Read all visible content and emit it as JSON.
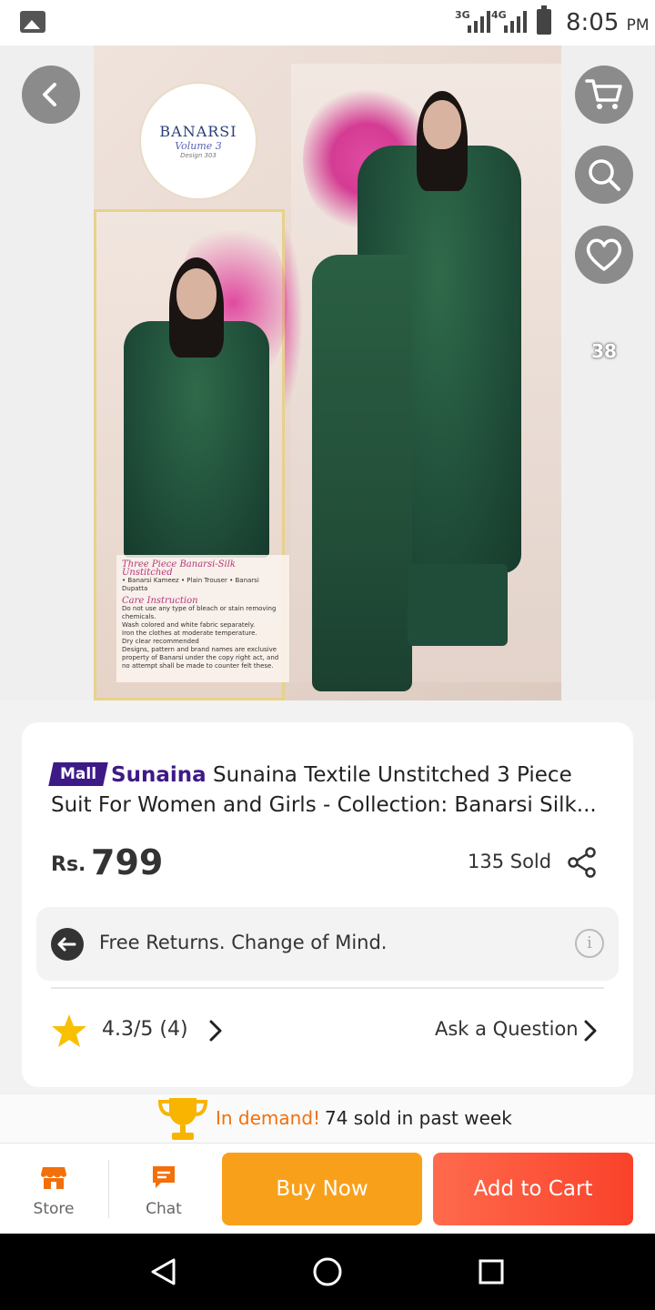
{
  "status_bar": {
    "network_1": "3G",
    "network_2": "4G",
    "time": "8:05",
    "ampm": "PM"
  },
  "gallery": {
    "logo_brand": "BANARSI",
    "logo_volume": "Volume 3",
    "logo_design": "Design 303",
    "caption_title": "Three Piece Banarsi-Silk Unstitched",
    "caption_items": "• Banarsi Kameez • Plain Trouser • Banarsi Dupatta",
    "care_title": "Care Instruction",
    "care_lines": [
      "Do not use any type of bleach or stain removing chemicals.",
      "Wash colored and white fabric separately.",
      "Iron the clothes at moderate temperature.",
      "Dry clear recommended",
      "Designs, pattern and brand names are exclusive property of Banarsi under the copy right act, and no attempt shall be made to counter felt these."
    ],
    "wishlist_count": "38",
    "icons": {
      "back": "back-arrow-icon",
      "cart": "cart-icon",
      "search": "search-icon",
      "wishlist": "heart-icon"
    }
  },
  "product": {
    "badge": "Mall",
    "store": "Sunaina",
    "title": "Sunaina Textile Unstitched 3 Piece Suit For Women and Girls - Collection: Banarsi Silk...",
    "currency": "Rs.",
    "price": "799",
    "sold": "135 Sold",
    "returns": "Free Returns. Change of Mind.",
    "rating": "4.3/5",
    "rating_count": "(4)",
    "ask": "Ask a Question"
  },
  "demand": {
    "label": "In demand!",
    "text": "74 sold in past week"
  },
  "bottom_bar": {
    "store": "Store",
    "chat": "Chat",
    "buy_now": "Buy Now",
    "add_to_cart": "Add to Cart"
  },
  "colors": {
    "mall_purple": "#3e1a87",
    "buy_now_orange": "#f9a01b",
    "add_cart_red": "#f9422a",
    "demand_orange": "#f36f0a",
    "star_yellow": "#f8c000"
  }
}
